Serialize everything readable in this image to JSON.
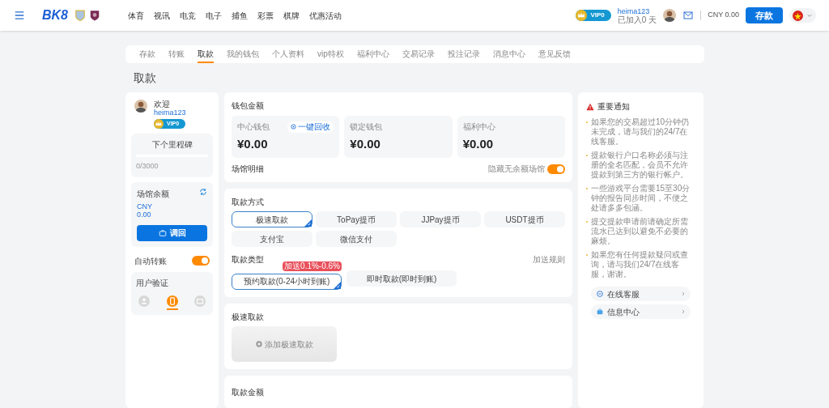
{
  "header": {
    "logo": "BK8",
    "nav": [
      "体育",
      "视讯",
      "电竞",
      "电子",
      "捕鱼",
      "彩票",
      "棋牌",
      "优惠活动"
    ],
    "vip": "VIP0",
    "username": "heima123",
    "joined": "已加入0 天",
    "balance": "CNY 0.00",
    "deposit": "存款"
  },
  "tabs": [
    {
      "label": "存款",
      "selected": false
    },
    {
      "label": "转账",
      "selected": false
    },
    {
      "label": "取款",
      "selected": true
    },
    {
      "label": "我的钱包",
      "selected": false
    },
    {
      "label": "个人资料",
      "selected": false
    },
    {
      "label": "vip特权",
      "selected": false
    },
    {
      "label": "福利中心",
      "selected": false
    },
    {
      "label": "交易记录",
      "selected": false
    },
    {
      "label": "投注记录",
      "selected": false
    },
    {
      "label": "消息中心",
      "selected": false
    },
    {
      "label": "意见反馈",
      "selected": false
    }
  ],
  "page_title": "取款",
  "sidebar": {
    "welcome": "欢迎",
    "username": "heima123",
    "vip": "VIP0",
    "milestone": {
      "title": "下个里程碑",
      "level": 0,
      "progress": "0/3000"
    },
    "venue": {
      "title": "场馆余额",
      "currency": "CNY",
      "amount": "0.00",
      "button": "调回"
    },
    "auto_transfer": {
      "label": "自动转账",
      "on": true
    },
    "verify": {
      "title": "用户验证",
      "items": [
        {
          "kind": "user",
          "selected": false
        },
        {
          "kind": "phone",
          "selected": true
        },
        {
          "kind": "mail",
          "selected": false
        }
      ]
    }
  },
  "wallets": {
    "title": "钱包金额",
    "cards": [
      {
        "name": "中心钱包",
        "amount": "¥0.00",
        "action": "一键回收"
      },
      {
        "name": "锁定钱包",
        "amount": "¥0.00"
      },
      {
        "name": "福利中心",
        "amount": "¥0.00"
      }
    ],
    "venue_detail": "场馆明细",
    "hide_toggle": {
      "label": "隐藏无余额场馆",
      "on": true
    }
  },
  "methods": {
    "title": "取款方式",
    "items": [
      {
        "label": "极速取款",
        "selected": true
      },
      {
        "label": "ToPay提币",
        "selected": false
      },
      {
        "label": "JJPay提币",
        "selected": false
      },
      {
        "label": "USDT提币",
        "selected": false
      },
      {
        "label": "支付宝",
        "selected": false
      },
      {
        "label": "微信支付",
        "selected": false
      }
    ]
  },
  "types": {
    "title": "取款类型",
    "rules": "加送规则",
    "items": [
      {
        "label": "预约取款(0-24小时到账)",
        "selected": true,
        "badge": "加送0.1%-0.6%"
      },
      {
        "label": "即时取款(即时到账)",
        "selected": false
      }
    ]
  },
  "fast": {
    "title": "极速取款",
    "add": "添加极速取款"
  },
  "amount_title": "取款金额",
  "notice": {
    "title": "重要通知",
    "items": [
      "如果您的交易超过10分钟仍未完成，请与我们的24/7在线客服。",
      "提款银行户口名称必须与注册的全名匹配，会员不允许提款到第三方的银行帐户。",
      "一些游戏平台需要15至30分钟的报告同步时间，不便之处请多多包涵。",
      "提交提款申请前请确定所需流水已达到以避免不必要的麻烦。",
      "如果您有任何提款疑问或查询，请与我们24/7在线客服，谢谢。"
    ],
    "links": [
      {
        "kind": "chat",
        "label": "在线客服"
      },
      {
        "kind": "help",
        "label": "信息中心"
      }
    ]
  }
}
